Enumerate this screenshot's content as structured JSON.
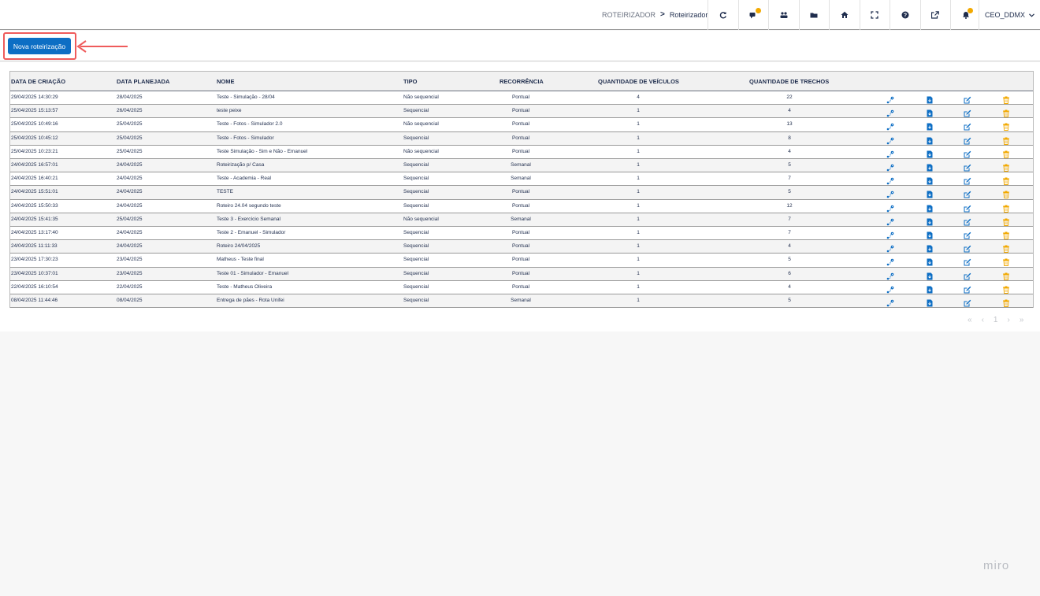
{
  "header": {
    "breadcrumb_parent": "ROTEIRIZADOR",
    "breadcrumb_separator": ">",
    "breadcrumb_current": "Roteirizador",
    "user_name": "CEO_DDMX",
    "icons": [
      "refresh-icon",
      "chat-icon",
      "users-icon",
      "folder-icon",
      "home-icon",
      "fullscreen-icon",
      "help-icon",
      "external-link-icon",
      "notifications-icon"
    ]
  },
  "toolbar": {
    "new_button_label": "Nova roteirização"
  },
  "table": {
    "headers": {
      "created": "DATA DE CRIAÇÃO",
      "planned": "DATA PLANEJADA",
      "name": "NOME",
      "type": "TIPO",
      "recurrence": "RECORRÊNCIA",
      "vehicles": "QUANTIDADE DE VEÍCULOS",
      "segments": "QUANTIDADE DE TRECHOS"
    },
    "rows": [
      {
        "created": "29/04/2025 14:30:29",
        "planned": "28/04/2025",
        "name": "Teste - Simulação - 28/04",
        "type": "Não sequencial",
        "recurrence": "Pontual",
        "vehicles": "4",
        "segments": "22"
      },
      {
        "created": "25/04/2025 15:13:57",
        "planned": "26/04/2025",
        "name": "teste peixe",
        "type": "Sequencial",
        "recurrence": "Pontual",
        "vehicles": "1",
        "segments": "4"
      },
      {
        "created": "25/04/2025 10:49:16",
        "planned": "25/04/2025",
        "name": "Teste - Fotos - Simulador 2.0",
        "type": "Não sequencial",
        "recurrence": "Pontual",
        "vehicles": "1",
        "segments": "13"
      },
      {
        "created": "25/04/2025 10:45:12",
        "planned": "25/04/2025",
        "name": "Teste - Fotos - Simulador",
        "type": "Sequencial",
        "recurrence": "Pontual",
        "vehicles": "1",
        "segments": "8"
      },
      {
        "created": "25/04/2025 10:23:21",
        "planned": "25/04/2025",
        "name": "Teste Simulação - Sim e Não - Emanuel",
        "type": "Não sequencial",
        "recurrence": "Pontual",
        "vehicles": "1",
        "segments": "4"
      },
      {
        "created": "24/04/2025 16:57:01",
        "planned": "24/04/2025",
        "name": "Roteirização p/ Casa",
        "type": "Sequencial",
        "recurrence": "Semanal",
        "vehicles": "1",
        "segments": "5"
      },
      {
        "created": "24/04/2025 16:40:21",
        "planned": "24/04/2025",
        "name": "Teste - Academia - Real",
        "type": "Sequencial",
        "recurrence": "Semanal",
        "vehicles": "1",
        "segments": "7"
      },
      {
        "created": "24/04/2025 15:51:01",
        "planned": "24/04/2025",
        "name": "TESTE",
        "type": "Sequencial",
        "recurrence": "Pontual",
        "vehicles": "1",
        "segments": "5"
      },
      {
        "created": "24/04/2025 15:50:33",
        "planned": "24/04/2025",
        "name": "Roteiro 24.04 segundo teste",
        "type": "Sequencial",
        "recurrence": "Pontual",
        "vehicles": "1",
        "segments": "12"
      },
      {
        "created": "24/04/2025 15:41:35",
        "planned": "25/04/2025",
        "name": "Teste 3 - Exercício Semanal",
        "type": "Não sequencial",
        "recurrence": "Semanal",
        "vehicles": "1",
        "segments": "7"
      },
      {
        "created": "24/04/2025 13:17:40",
        "planned": "24/04/2025",
        "name": "Teste 2 - Emanuel - Simulador",
        "type": "Sequencial",
        "recurrence": "Pontual",
        "vehicles": "1",
        "segments": "7"
      },
      {
        "created": "24/04/2025 11:11:33",
        "planned": "24/04/2025",
        "name": "Roteiro 24/04/2025",
        "type": "Sequencial",
        "recurrence": "Pontual",
        "vehicles": "1",
        "segments": "4"
      },
      {
        "created": "23/04/2025 17:30:23",
        "planned": "23/04/2025",
        "name": "Matheus - Teste final",
        "type": "Sequencial",
        "recurrence": "Pontual",
        "vehicles": "1",
        "segments": "5"
      },
      {
        "created": "23/04/2025 10:37:01",
        "planned": "23/04/2025",
        "name": "Teste 01 - Simulador - Emanuel",
        "type": "Sequencial",
        "recurrence": "Pontual",
        "vehicles": "1",
        "segments": "6"
      },
      {
        "created": "22/04/2025 16:10:54",
        "planned": "22/04/2025",
        "name": "Teste - Matheus Oliveira",
        "type": "Sequencial",
        "recurrence": "Pontual",
        "vehicles": "1",
        "segments": "4"
      },
      {
        "created": "08/04/2025 11:44:46",
        "planned": "08/04/2025",
        "name": "Entrega de pães - Rota Unifei",
        "type": "Sequencial",
        "recurrence": "Semanal",
        "vehicles": "1",
        "segments": "5"
      }
    ],
    "row_actions": [
      "route-map-icon",
      "document-download-icon",
      "edit-icon",
      "delete-icon"
    ]
  },
  "pagination": {
    "first": "«",
    "prev": "‹",
    "page": "1",
    "next": "›",
    "last": "»"
  },
  "watermark": "miro",
  "colors": {
    "primary": "#0d6ec4",
    "highlight": "#ef5b5b",
    "delete": "#f2a900",
    "badge": "#f2a900"
  }
}
